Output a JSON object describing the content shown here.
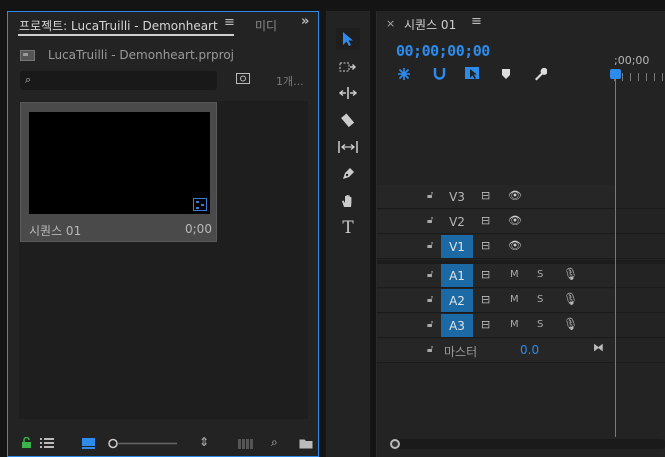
{
  "project": {
    "tab_title": "프로젝트: LucaTruilli - Demonheart",
    "tab_menu": "≡",
    "tab2": "미디",
    "tab_more": "»",
    "file_name": "LucaTruilli - Demonheart.prproj",
    "search": {
      "placeholder": ""
    },
    "item_count": "1개...",
    "clip": {
      "name": "시퀀스 01",
      "duration": "0;00"
    }
  },
  "tools": {
    "items": [
      "selection",
      "track-select",
      "ripple",
      "razor",
      "slip",
      "pen",
      "hand",
      "type"
    ],
    "type_glyph": "T"
  },
  "timeline": {
    "close": "×",
    "title": "시퀀스 01",
    "menu": "≡",
    "timecode": "00;00;00;00",
    "ruler_label": ";00;00",
    "video_tracks": [
      {
        "label": "V3",
        "targeted": false
      },
      {
        "label": "V2",
        "targeted": false
      },
      {
        "label": "V1",
        "targeted": true
      }
    ],
    "audio_tracks": [
      {
        "label": "A1",
        "targeted": true,
        "m": "M",
        "s": "S"
      },
      {
        "label": "A2",
        "targeted": true,
        "m": "M",
        "s": "S"
      },
      {
        "label": "A3",
        "targeted": true,
        "m": "M",
        "s": "S"
      }
    ],
    "master": {
      "label": "마스터",
      "value": "0.0"
    }
  },
  "colors": {
    "accent": "#2d8ceb",
    "track_target": "#1b6aa5",
    "panel_bg": "#232323"
  }
}
